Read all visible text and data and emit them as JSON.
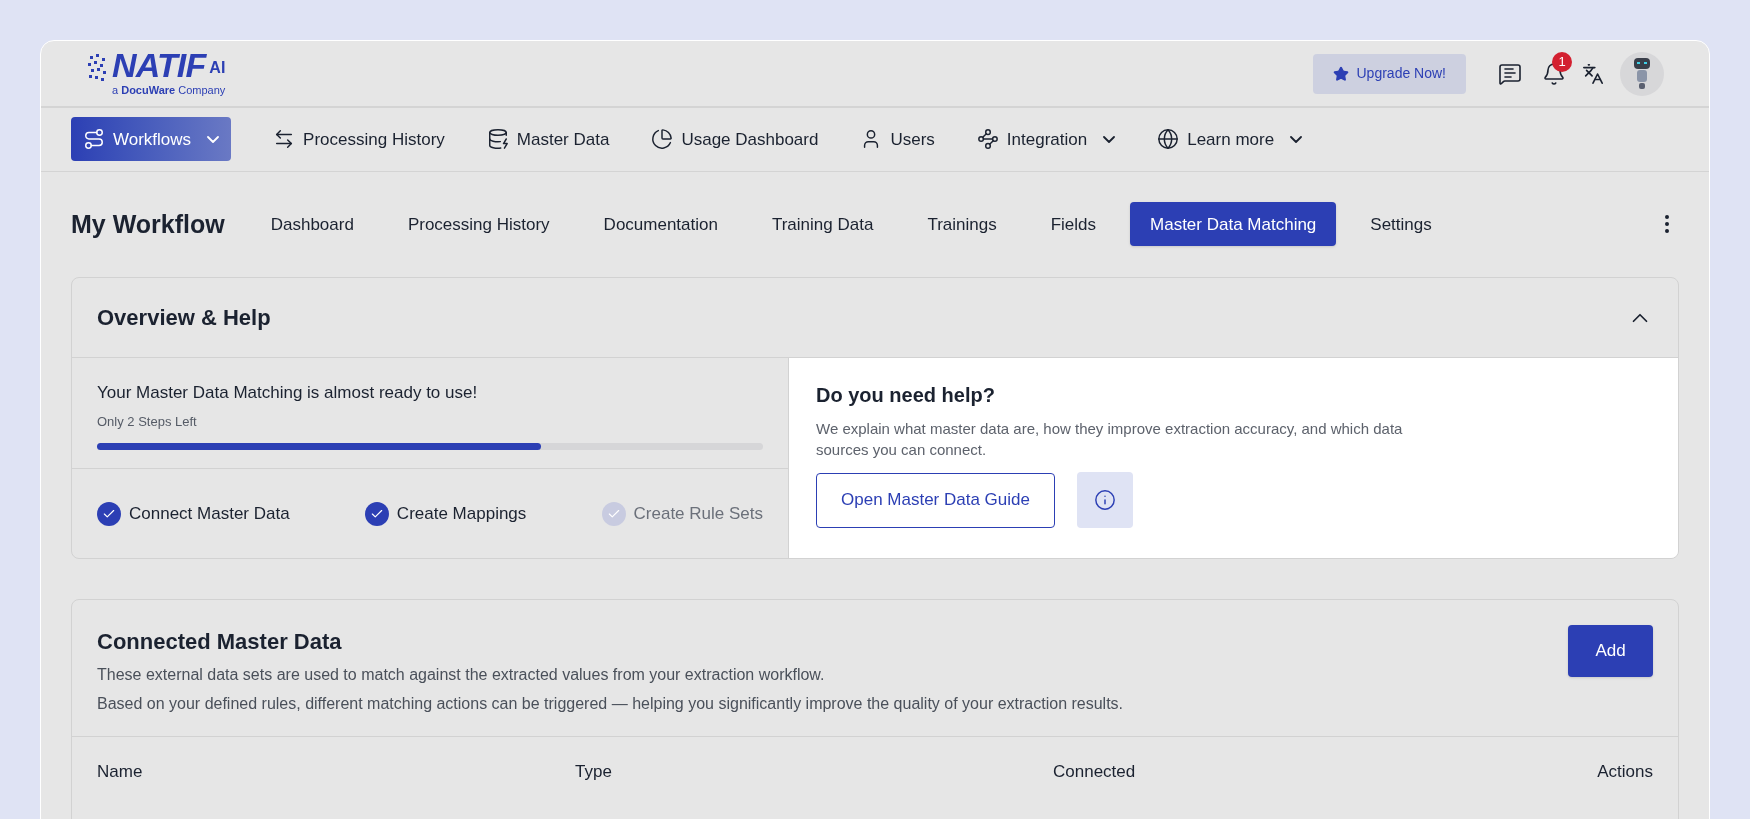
{
  "header": {
    "logo": {
      "name": "NATIF",
      "suffix": "AI",
      "tagline": "a **DocuWare** Company"
    },
    "upgrade_button": "Upgrade Now!",
    "notification_count": "1"
  },
  "nav": [
    {
      "label": "Workflows",
      "selected": true,
      "dropdown": true
    },
    {
      "label": "Processing History",
      "selected": false,
      "dropdown": false
    },
    {
      "label": "Master Data",
      "selected": false,
      "dropdown": false
    },
    {
      "label": "Usage Dashboard",
      "selected": false,
      "dropdown": false
    },
    {
      "label": "Users",
      "selected": false,
      "dropdown": false
    },
    {
      "label": "Integration",
      "selected": false,
      "dropdown": true
    },
    {
      "label": "Learn more",
      "selected": false,
      "dropdown": true
    }
  ],
  "workflow": {
    "title": "My Workflow",
    "tabs": [
      {
        "label": "Dashboard",
        "selected": false
      },
      {
        "label": "Processing History",
        "selected": false
      },
      {
        "label": "Documentation",
        "selected": false
      },
      {
        "label": "Training Data",
        "selected": false
      },
      {
        "label": "Trainings",
        "selected": false
      },
      {
        "label": "Fields",
        "selected": false
      },
      {
        "label": "Master Data Matching",
        "selected": true
      },
      {
        "label": "Settings",
        "selected": false
      }
    ]
  },
  "overview": {
    "title": "Overview & Help",
    "expanded": true,
    "progress": {
      "title": "Your Master Data Matching is almost ready to use!",
      "subtitle": "Only 2 Steps Left",
      "level": 0.667
    },
    "steps": [
      {
        "label": "Connect Master Data",
        "done": true
      },
      {
        "label": "Create Mappings",
        "done": true
      },
      {
        "label": "Create Rule Sets",
        "done": false
      }
    ],
    "help": {
      "title": "Do you need help?",
      "description": "We explain what master data are, how they improve extraction accuracy, and which data sources you can connect.",
      "button": "Open Master Data Guide"
    }
  },
  "connected": {
    "title": "Connected Master Data",
    "description": [
      "These external data sets are used to match against the extracted values from your extraction workflow.",
      "Based on your defined rules, different matching actions can be triggered — helping you significantly improve the quality of your extraction results."
    ],
    "add_button": "Add",
    "columns": [
      "Name",
      "Type",
      "Connected",
      "Actions"
    ]
  }
}
